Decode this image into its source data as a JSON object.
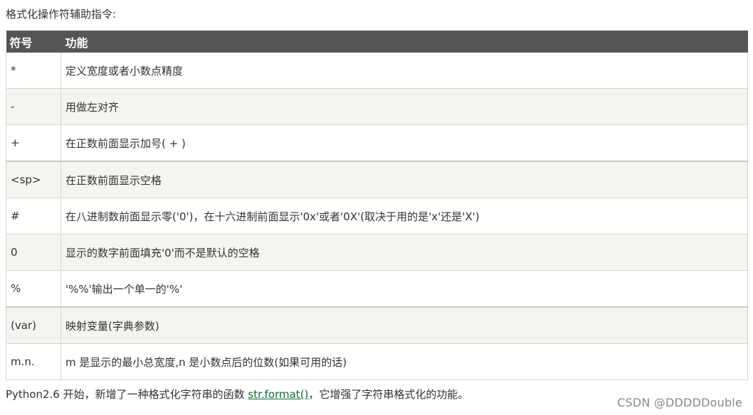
{
  "intro_text": "格式化操作符辅助指令:",
  "table": {
    "headers": {
      "symbol": "符号",
      "function": "功能"
    },
    "rows": [
      {
        "symbol": "*",
        "function": "定义宽度或者小数点精度"
      },
      {
        "symbol": "-",
        "function": "用做左对齐"
      },
      {
        "symbol": "+",
        "function": "在正数前面显示加号( + )"
      },
      {
        "symbol": "<sp>",
        "function": "在正数前面显示空格"
      },
      {
        "symbol": "#",
        "function": "在八进制数前面显示零('0')，在十六进制前面显示'0x'或者'0X'(取决于用的是'x'还是'X')"
      },
      {
        "symbol": "0",
        "function": "显示的数字前面填充'0'而不是默认的空格"
      },
      {
        "symbol": "%",
        "function": "'%%'输出一个单一的'%'"
      },
      {
        "symbol": "(var)",
        "function": "映射变量(字典参数)"
      },
      {
        "symbol": "m.n.",
        "function": "m 是显示的最小总宽度,n 是小数点后的位数(如果可用的话)"
      }
    ]
  },
  "footer": {
    "before_link": "Python2.6 开始，新增了一种格式化字符串的函数 ",
    "link_text": "str.format()",
    "after_link": "，它增强了字符串格式化的功能。"
  },
  "watermark": "CSDN @DDDDDouble",
  "colors": {
    "header_bg": "#555555",
    "shade_row_bg": "#f6f4f0",
    "link": "#0b6a34"
  }
}
